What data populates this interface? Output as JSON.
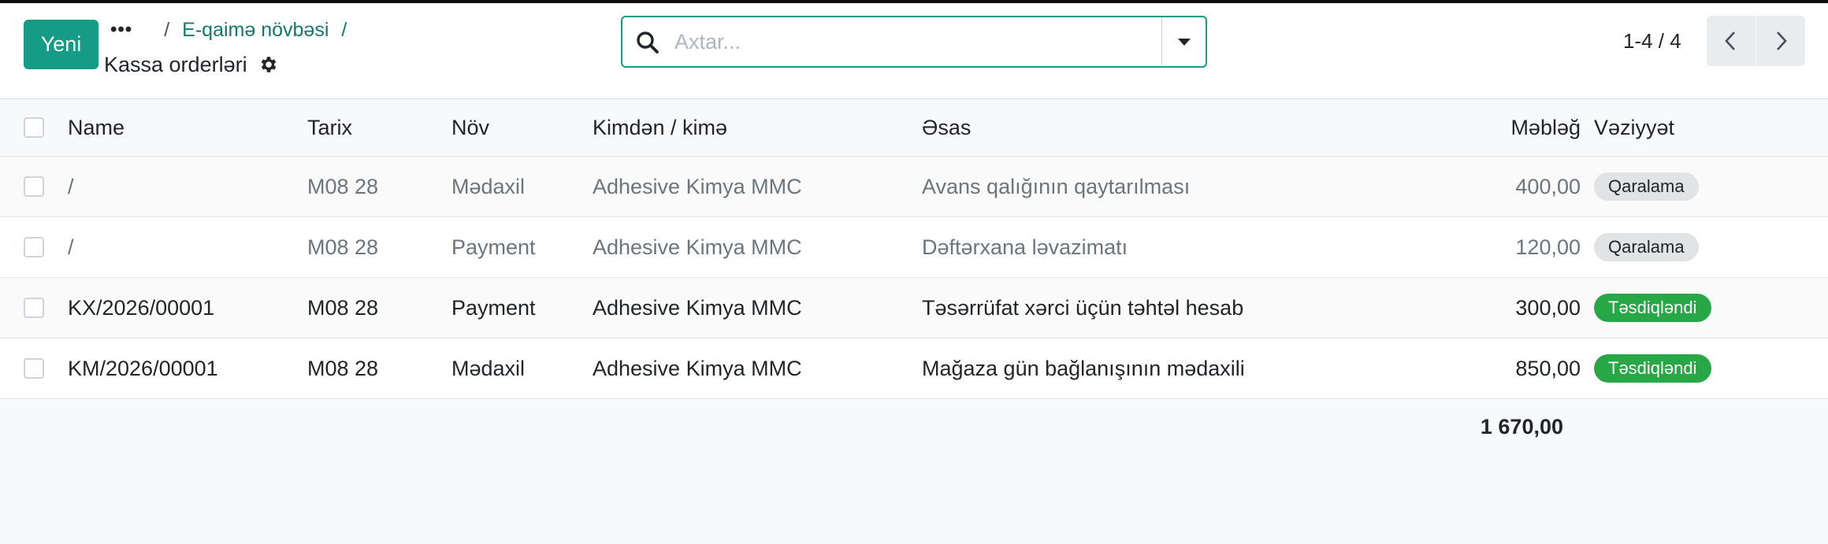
{
  "toolbar": {
    "new_label": "Yeni"
  },
  "breadcrumb": {
    "more": "•••",
    "sep": "/",
    "parent": "E-qaimə növbəsi",
    "current_sep": "/",
    "title": "Kassa orderləri"
  },
  "search": {
    "placeholder": "Axtar..."
  },
  "pager": {
    "value": "1-4 / 4"
  },
  "columns": {
    "name": "Name",
    "date": "Tarix",
    "type": "Növ",
    "partner": "Kimdən / kimə",
    "reason": "Əsas",
    "amount": "Məbləğ",
    "state": "Vəziyyət"
  },
  "rows": [
    {
      "name": "/",
      "date": "M08 28",
      "type": "Mədaxil",
      "partner": "Adhesive Kimya MMC",
      "reason": "Avans qalığının qaytarılması",
      "amount": "400,00",
      "state": "Qaralama"
    },
    {
      "name": "/",
      "date": "M08 28",
      "type": "Payment",
      "partner": "Adhesive Kimya MMC",
      "reason": "Dəftərxana ləvazimatı",
      "amount": "120,00",
      "state": "Qaralama"
    },
    {
      "name": "KX/2026/00001",
      "date": "M08 28",
      "type": "Payment",
      "partner": "Adhesive Kimya MMC",
      "reason": "Təsərrüfat xərci üçün təhtəl hesab",
      "amount": "300,00",
      "state": "Təsdiqləndi"
    },
    {
      "name": "KM/2026/00001",
      "date": "M08 28",
      "type": "Mədaxil",
      "partner": "Adhesive Kimya MMC",
      "reason": "Mağaza gün bağlanışının mədaxili",
      "amount": "850,00",
      "state": "Təsdiqləndi"
    }
  ],
  "total": "1 670,00",
  "colors": {
    "accent": "#159b86",
    "draft_badge": "#e2e3e5",
    "done_badge": "#27a745"
  },
  "icons": {
    "search": "search-icon",
    "gear": "gear-icon",
    "dropdown": "caret-down-icon",
    "prev": "chevron-left-icon",
    "next": "chevron-right-icon"
  }
}
